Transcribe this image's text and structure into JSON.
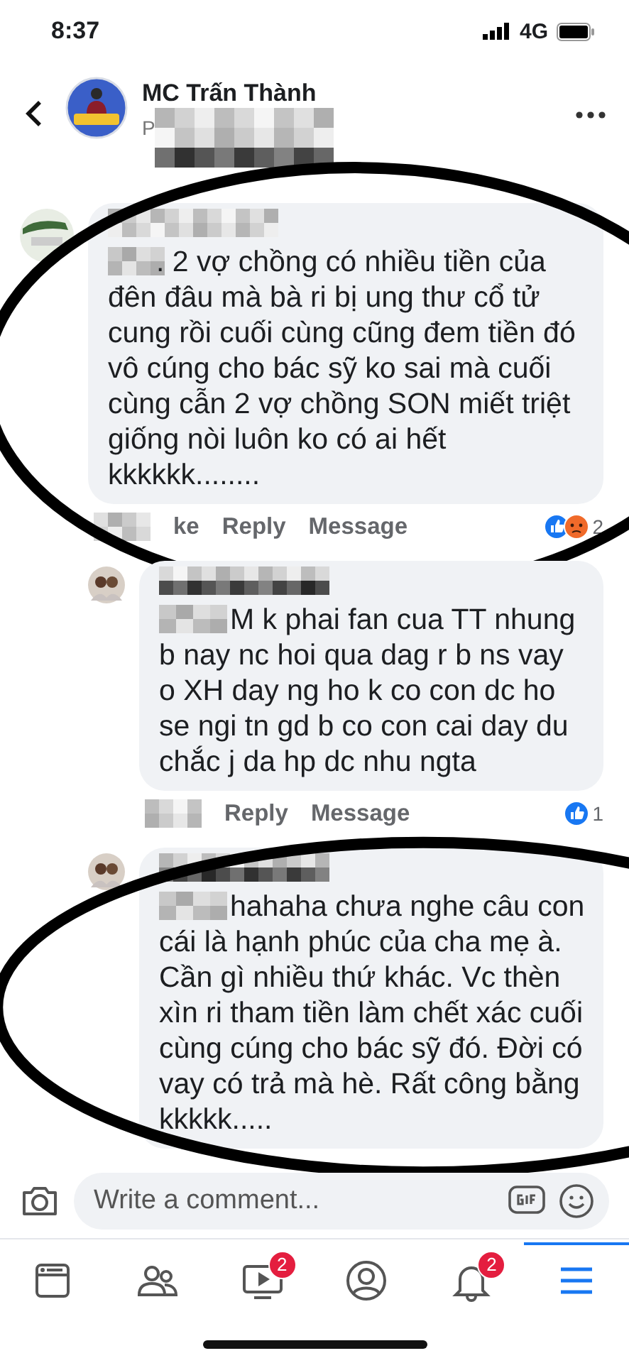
{
  "status_bar": {
    "time": "8:37",
    "network": "4G"
  },
  "header": {
    "title": "MC Trấn Thành",
    "subtitle": "P"
  },
  "comments": [
    {
      "reply": false,
      "circled": true,
      "text": ". 2 vợ chồng có nhiều tiền của đên đâu mà bà ri bị ung thư cổ tử cung rồi cuối cùng cũng đem tiền đó vô cúng cho bác sỹ ko sai mà cuối cùng cẫn 2 vợ chồng SON miết triệt giống nòi luôn ko có ai hết kkkkkk........",
      "actions": [
        "ke",
        "Reply",
        "Message"
      ],
      "reactions": [
        {
          "kind": "like"
        },
        {
          "kind": "angry"
        }
      ],
      "reaction_count": "2"
    },
    {
      "reply": true,
      "circled": false,
      "text": "M k phai fan cua TT nhung b nay nc hoi qua dag r b ns vay o XH day ng ho k co con dc ho se ngi tn gd b co con cai day du chắc j da hp dc nhu ngta",
      "actions": [
        "Reply",
        "Message"
      ],
      "reactions": [
        {
          "kind": "like"
        }
      ],
      "reaction_count": "1"
    },
    {
      "reply": true,
      "circled": true,
      "text": "hahaha chưa nghe câu con cái là hạnh phúc của cha mẹ à. Cần gì nhiều thứ khác. Vc thèn xìn ri tham tiền làm chết xác cuối cùng cúng cho bác sỹ đó. Đời có vay có trả mà hè. Rất công bằng kkkkk....."
    }
  ],
  "composer": {
    "placeholder": "Write a comment..."
  },
  "tabs": [
    {
      "kind": "news",
      "selected": false
    },
    {
      "kind": "friends",
      "selected": false
    },
    {
      "kind": "watch",
      "selected": false,
      "badge": "2"
    },
    {
      "kind": "profile",
      "selected": false
    },
    {
      "kind": "bell",
      "selected": false,
      "badge": "2"
    },
    {
      "kind": "menu",
      "selected": true
    }
  ]
}
